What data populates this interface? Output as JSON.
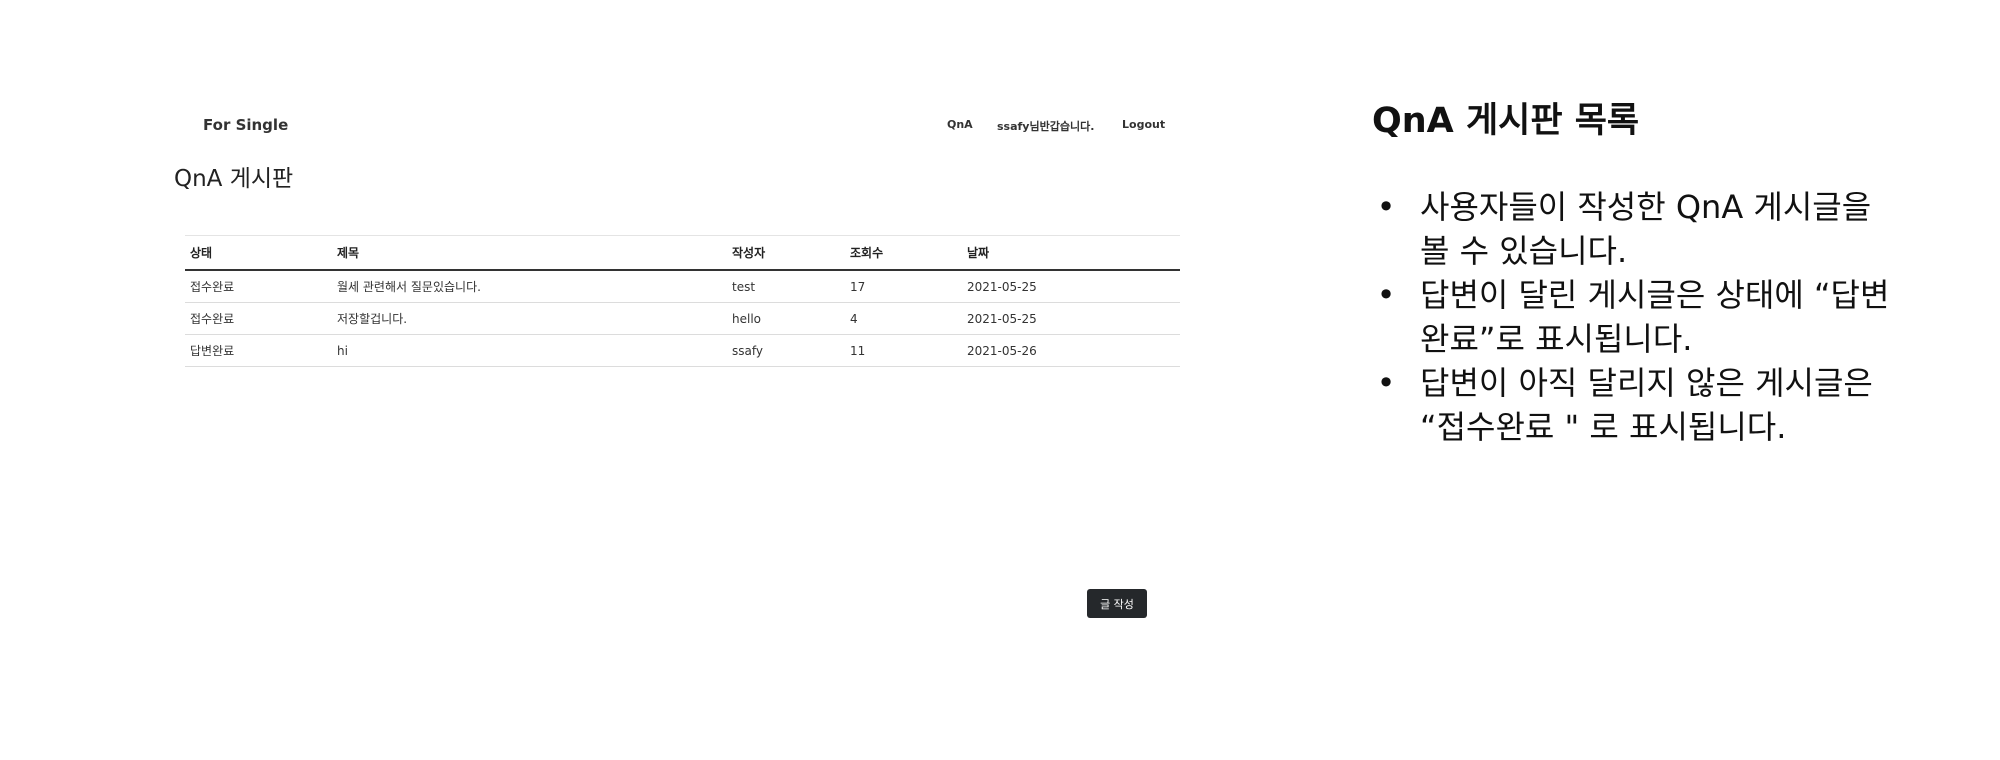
{
  "app": {
    "brand": "For Single",
    "nav": {
      "qna": "QnA",
      "user_greeting": "ssafy님반갑습니다.",
      "logout": "Logout"
    },
    "page_title": "QnA 게시판",
    "table": {
      "headers": [
        "상태",
        "제목",
        "작성자",
        "조회수",
        "날짜"
      ],
      "rows": [
        [
          "접수완료",
          "월세 관련해서 질문있습니다.",
          "test",
          "17",
          "2021-05-25"
        ],
        [
          "접수완료",
          "저장할겁니다.",
          "hello",
          "4",
          "2021-05-25"
        ],
        [
          "답변완료",
          "hi",
          "ssafy",
          "11",
          "2021-05-26"
        ]
      ]
    },
    "write_button": "글 작성"
  },
  "description": {
    "title": "QnA 게시판 목록",
    "bullet_icon": "•",
    "points": [
      "사용자들이 작성한 QnA 게시글을 볼 수 있습니다.",
      "답변이 달린 게시글은 상태에 “답변완료”로 표시됩니다.",
      "답변이 아직 달리지 않은 게시글은 “접수완료 \" 로 표시됩니다."
    ]
  }
}
